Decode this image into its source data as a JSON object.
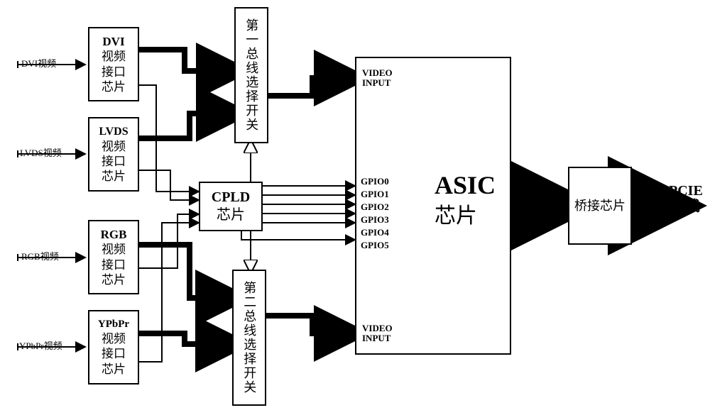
{
  "inputs": {
    "dvi": "DVI视频",
    "lvds": "LVDS视频",
    "rgb": "RGB视频",
    "ypbpr": "YPbPr视频"
  },
  "chips": {
    "dvi": {
      "title": "DVI",
      "line2": "视频",
      "line3": "接口",
      "line4": "芯片"
    },
    "lvds": {
      "title": "LVDS",
      "line2": "视频",
      "line3": "接口",
      "line4": "芯片"
    },
    "rgb": {
      "title": "RGB",
      "line2": "视频",
      "line3": "接口",
      "line4": "芯片"
    },
    "ypbpr": {
      "title": "YPbPr",
      "line2": "视频",
      "line3": "接口",
      "line4": "芯片"
    },
    "cpld": {
      "title": "CPLD",
      "sub": "芯片"
    },
    "asic": {
      "title": "ASIC",
      "sub": "芯片"
    },
    "bridge": {
      "label": "桥接芯片"
    }
  },
  "selectors": {
    "first": "第一总线选择开关",
    "second": "第二总线选择开关"
  },
  "asic_ports": {
    "video_input": "VIDEO\nINPUT",
    "gpio0": "GPIO0",
    "gpio1": "GPIO1",
    "gpio2": "GPIO2",
    "gpio3": "GPIO3",
    "gpio4": "GPIO4",
    "gpio5": "GPIO5"
  },
  "output": {
    "pcie_line1": "PCIE",
    "pcie_line2": "总线"
  }
}
